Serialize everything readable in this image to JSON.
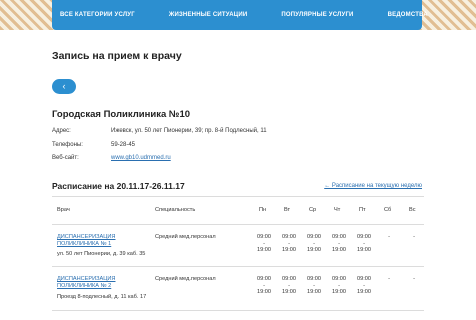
{
  "nav": {
    "items": [
      "ВСЕ КАТЕГОРИИ УСЛУГ",
      "ЖИЗНЕННЫЕ СИТУАЦИИ",
      "ПОПУЛЯРНЫЕ УСЛУГИ",
      "ВЕДОМСТВА"
    ]
  },
  "page": {
    "title": "Запись на прием к врачу",
    "back_symbol": "‹"
  },
  "clinic": {
    "name": "Городская Поликлиника №10",
    "address_label": "Адрес:",
    "address": "Ижевск, ул. 50 лет Пионерии, 39; пр. 8-й Подлесный, 11",
    "phones_label": "Телефоны:",
    "phones": "59-28-45",
    "website_label": "Веб-сайт:",
    "website": "www.gb10.udmmed.ru"
  },
  "schedule": {
    "title": "Расписание на 20.11.17-26.11.17",
    "current_week_link": "← Расписание на текущую неделю",
    "columns": {
      "doctor": "Врач",
      "specialty": "Специальность",
      "days": [
        "Пн",
        "Вт",
        "Ср",
        "Чт",
        "Пт",
        "Сб",
        "Вс"
      ]
    },
    "rows": [
      {
        "doctor": "ДИСПАНСЕРИЗАЦИЯ ПОЛИКЛИНИКА № 1",
        "address": "ул. 50 лет Пионерии, д. 39 каб. 35",
        "specialty": "Средний мед.персонал",
        "hours": [
          "09:00 - 19:00",
          "09:00 - 19:00",
          "09:00 - 19:00",
          "09:00 - 19:00",
          "09:00 - 19:00",
          "-",
          "-"
        ]
      },
      {
        "doctor": "ДИСПАНСЕРИЗАЦИЯ ПОЛИКЛИНИКА № 2",
        "address": "Проезд 8-подлесный, д. 11 каб. 17",
        "specialty": "Средний мед.персонал",
        "hours": [
          "09:00 - 19:00",
          "09:00 - 19:00",
          "09:00 - 19:00",
          "09:00 - 19:00",
          "09:00 - 19:00",
          "-",
          "-"
        ]
      }
    ]
  }
}
